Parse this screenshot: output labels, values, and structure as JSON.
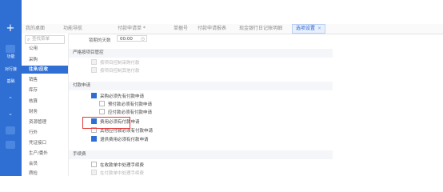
{
  "tabs": [
    {
      "label": "我的桌面",
      "active": false
    },
    {
      "label": "功能导航",
      "active": false
    },
    {
      "label": "付款申请单 *",
      "active": false
    },
    {
      "label": "单据号",
      "active": false
    },
    {
      "label": "付款申请报表",
      "active": false
    },
    {
      "label": "现金银行日记账明细",
      "active": false
    },
    {
      "label": "选项设置",
      "active": true
    }
  ],
  "menu": {
    "search_placeholder": "查找菜单",
    "items": [
      {
        "label": "公用",
        "active": false
      },
      {
        "label": "采购",
        "active": false
      },
      {
        "label": "往来/应收",
        "active": true
      },
      {
        "label": "销售",
        "active": false
      },
      {
        "label": "库存",
        "active": false
      },
      {
        "label": "核算",
        "active": false
      },
      {
        "label": "财务",
        "active": false
      },
      {
        "label": "资源管理",
        "active": false
      },
      {
        "label": "行外",
        "active": false
      },
      {
        "label": "凭证接口",
        "active": false
      },
      {
        "label": "生产/委外",
        "active": false
      },
      {
        "label": "会员",
        "active": false
      },
      {
        "label": "质检",
        "active": false
      }
    ]
  },
  "rail": {
    "labels": [
      "功能",
      "对行接",
      "基础"
    ]
  },
  "main": {
    "lock_days_label": "锁期的天数",
    "lock_days_value": "00:00",
    "section1": "严格按项目管控",
    "section1_rows": [
      {
        "label": "按项目控制采购付款",
        "checked": false,
        "disabled": true
      },
      {
        "label": "按项目控制其他付款",
        "checked": false,
        "disabled": true
      }
    ],
    "section2": "付款申请",
    "section2_rows": [
      {
        "label": "采购必须先有付款申请",
        "checked": true,
        "disabled": false
      },
      {
        "label": "预付款必须有付款申请",
        "checked": false,
        "disabled": false
      },
      {
        "label": "应付款必须有付款申请",
        "checked": false,
        "disabled": false
      },
      {
        "label": "费用必须有付款申请",
        "checked": true,
        "disabled": false
      },
      {
        "label": "其他应付款必须有付款申请",
        "checked": false,
        "disabled": false
      },
      {
        "label": "退供费用必须有付款申请",
        "checked": true,
        "disabled": false
      }
    ],
    "section3": "手续费",
    "section3_rows": [
      {
        "label": "在收款单中处理手续费",
        "checked": false,
        "disabled": false
      },
      {
        "label": "在付款单中处理手续费",
        "checked": false,
        "disabled": true
      }
    ]
  },
  "colors": {
    "accent": "#2f6fd4",
    "highlight_box": "#e23a3a"
  }
}
